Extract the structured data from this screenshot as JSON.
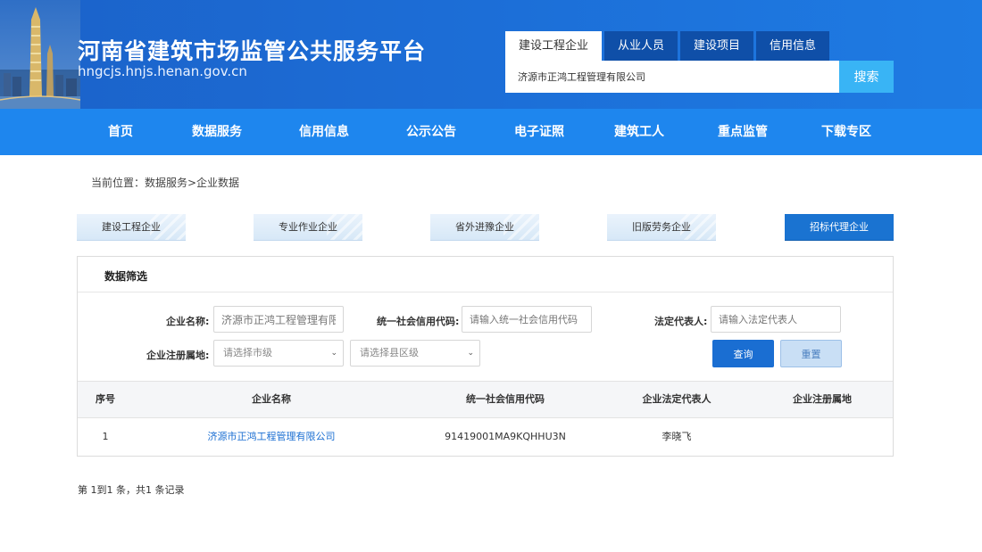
{
  "header": {
    "site_title": "河南省建筑市场监管公共服务平台",
    "site_url": "hngcjs.hnjs.henan.gov.cn"
  },
  "search": {
    "tabs": [
      "建设工程企业",
      "从业人员",
      "建设项目",
      "信用信息"
    ],
    "active_tab": 0,
    "value": "济源市正鸿工程管理有限公司",
    "button": "搜索"
  },
  "nav": {
    "items": [
      "首页",
      "数据服务",
      "信用信息",
      "公示公告",
      "电子证照",
      "建筑工人",
      "重点监管",
      "下载专区"
    ]
  },
  "breadcrumb": "当前位置：数据服务>企业数据",
  "category_tabs": {
    "items": [
      "建设工程企业",
      "专业作业企业",
      "省外进豫企业",
      "旧版劳务企业",
      "招标代理企业"
    ],
    "active": 4
  },
  "filter": {
    "title": "数据筛选",
    "company_name_label": "企业名称:",
    "company_name_value": "济源市正鸿工程管理有限公司",
    "credit_code_label": "统一社会信用代码:",
    "credit_code_placeholder": "请输入统一社会信用代码",
    "legal_rep_label": "法定代表人:",
    "legal_rep_placeholder": "请输入法定代表人",
    "region_label": "企业注册属地:",
    "city_placeholder": "请选择市级",
    "county_placeholder": "请选择县区级",
    "query_button": "查询",
    "reset_button": "重置"
  },
  "table": {
    "headers": [
      "序号",
      "企业名称",
      "统一社会信用代码",
      "企业法定代表人",
      "企业注册属地"
    ],
    "rows": [
      [
        "1",
        "济源市正鸿工程管理有限公司",
        "91419001MA9KQHHU3N",
        "李晓飞",
        ""
      ]
    ]
  },
  "pager": "第 1到1 条，共1 条记录",
  "colors": {
    "header_blue": "#1b62c9",
    "nav_blue": "#1e86ee",
    "search_button": "#39b4f5",
    "active_tab": "#1a73d1",
    "link": "#1a6ed2"
  }
}
